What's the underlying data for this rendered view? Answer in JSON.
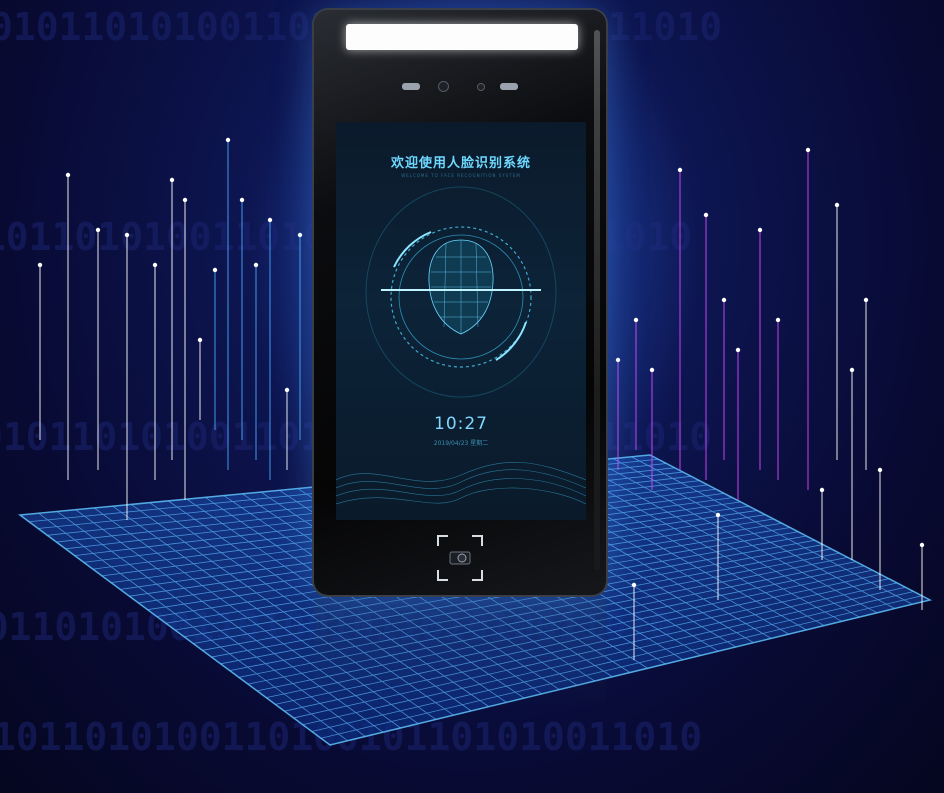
{
  "screen": {
    "welcome_title": "欢迎使用人脸识别系统",
    "welcome_subtitle": "WELCOME TO FACE RECOGNITION SYSTEM",
    "time": "10:27",
    "date": "2019/04/23 星期二"
  },
  "background": {
    "binary_pattern": "0101101010011010",
    "colors": {
      "deep_navy": "#07082a",
      "glow_blue": "#3c8cff",
      "grid_cyan": "#3aa8ff",
      "streak_blue": "#4aa8ff",
      "streak_magenta": "#d84cff",
      "streak_white": "#ffffff"
    }
  },
  "device": {
    "color": "#050506",
    "light_bar_color": "#fdfdfd",
    "accent_cyan": "#6fd8ff",
    "icons": [
      "sensor-icon",
      "camera-icon",
      "face-scan-icon",
      "qr-scanner-icon"
    ]
  }
}
